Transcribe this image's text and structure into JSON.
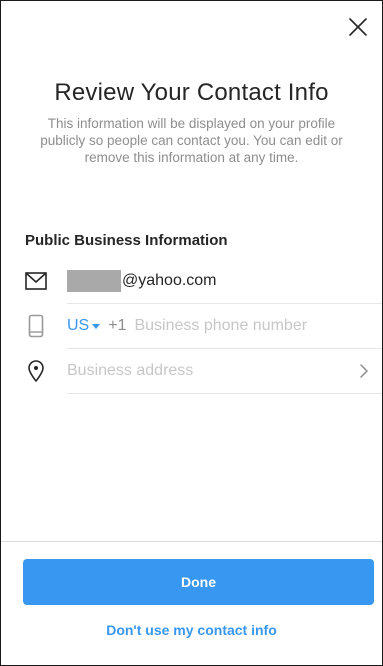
{
  "header": {
    "title": "Review Your Contact Info",
    "subtitle": "This information will be displayed on your profile publicly so people can contact you. You can edit or remove this information at any time.",
    "close_icon": "close-icon"
  },
  "section": {
    "heading": "Public Business Information"
  },
  "fields": {
    "email": {
      "icon": "mail-icon",
      "value": "@yahoo.com"
    },
    "phone": {
      "icon": "phone-icon",
      "country": "US",
      "dial_code": "+1",
      "placeholder": "Business phone number",
      "value": ""
    },
    "address": {
      "icon": "location-pin-icon",
      "placeholder": "Business address",
      "chevron_icon": "chevron-right-icon"
    }
  },
  "actions": {
    "done_label": "Done",
    "skip_label": "Don't use my contact info"
  },
  "colors": {
    "accent": "#3897f0",
    "text": "#262626",
    "muted": "#8e8e8e",
    "placeholder": "#c7c7c7",
    "divider": "#e6e6e6"
  }
}
